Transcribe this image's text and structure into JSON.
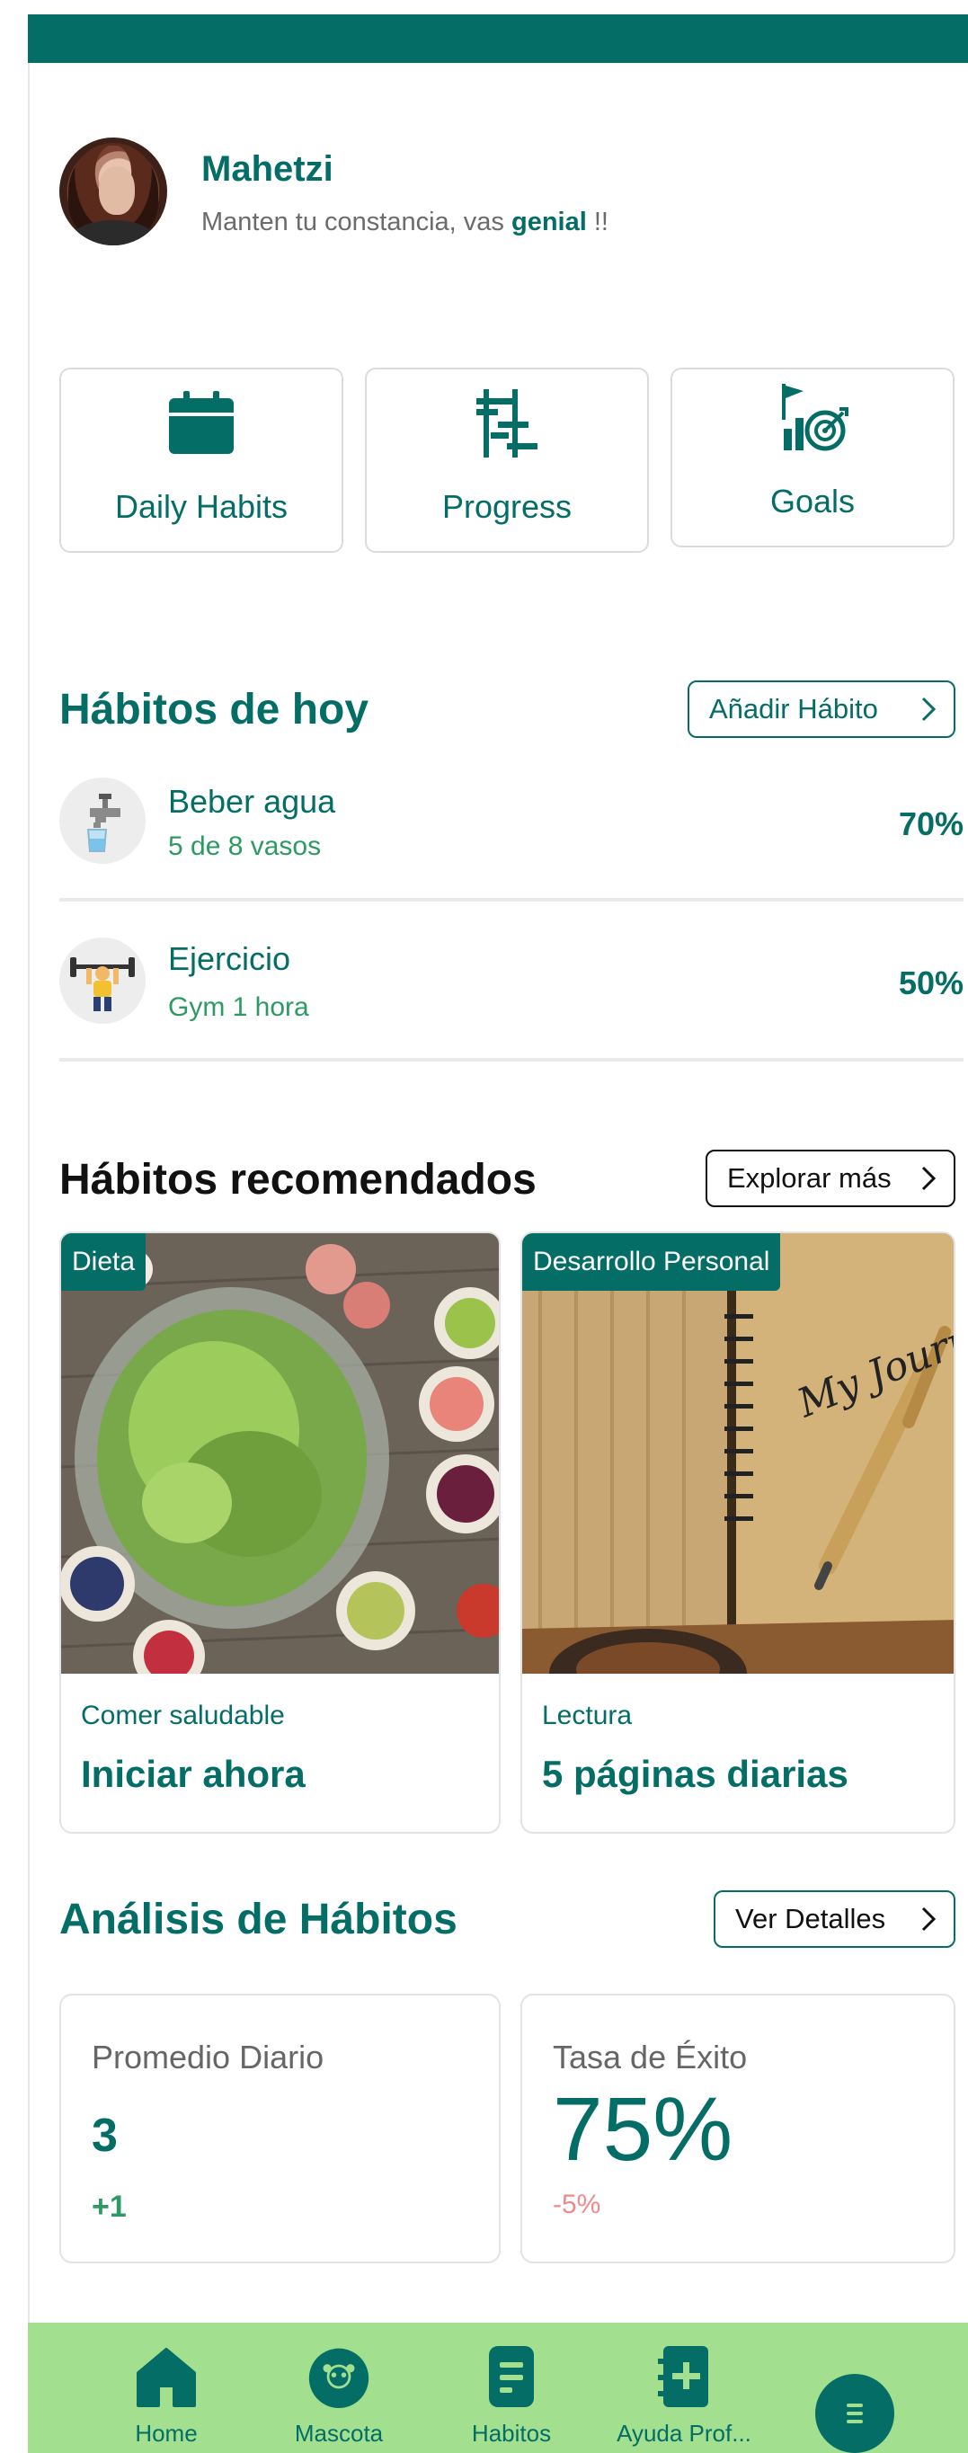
{
  "colors": {
    "primary": "#046d66",
    "accent_green": "#2e9a63",
    "nav_bg": "#a2df8f",
    "negative": "#f08a8a"
  },
  "profile": {
    "name": "Mahetzi",
    "message_prefix": "Manten tu constancia, vas ",
    "message_highlight": "genial",
    "message_suffix": " !!"
  },
  "quick_cards": [
    {
      "label": "Daily Habits",
      "icon": "calendar-icon"
    },
    {
      "label": "Progress",
      "icon": "progress-chart-icon"
    },
    {
      "label": "Goals",
      "icon": "goals-target-icon"
    }
  ],
  "today": {
    "title": "Hábitos de hoy",
    "add_button": "Añadir Hábito",
    "habits": [
      {
        "name": "Beber agua",
        "detail": "5 de 8 vasos",
        "percent": "70%",
        "icon": "water-faucet-icon"
      },
      {
        "name": "Ejercicio",
        "detail": "Gym 1 hora",
        "percent": "50%",
        "icon": "weightlifter-icon"
      }
    ]
  },
  "recommended": {
    "title": "Hábitos recomendados",
    "explore_button": "Explorar más",
    "cards": [
      {
        "tag": "Dieta",
        "subtitle": "Comer saludable",
        "action": "Iniciar ahora"
      },
      {
        "tag": "Desarrollo Personal",
        "subtitle": "Lectura",
        "action": "5 páginas diarias",
        "journal_text": "My Journal"
      }
    ]
  },
  "analysis": {
    "title": "Análisis de Hábitos",
    "details_button": "Ver Detalles",
    "daily_average": {
      "label": "Promedio Diario",
      "value": "3",
      "change": "+1"
    },
    "success_rate": {
      "label": "Tasa de Éxito",
      "value": "75%",
      "change": "-5%"
    }
  },
  "nav": {
    "items": [
      {
        "label": "Home",
        "icon": "home-icon"
      },
      {
        "label": "Mascota",
        "icon": "pet-icon"
      },
      {
        "label": "Habitos",
        "icon": "document-icon"
      },
      {
        "label": "Ayuda Prof...",
        "icon": "add-help-icon"
      }
    ],
    "menu_icon": "menu-icon"
  }
}
